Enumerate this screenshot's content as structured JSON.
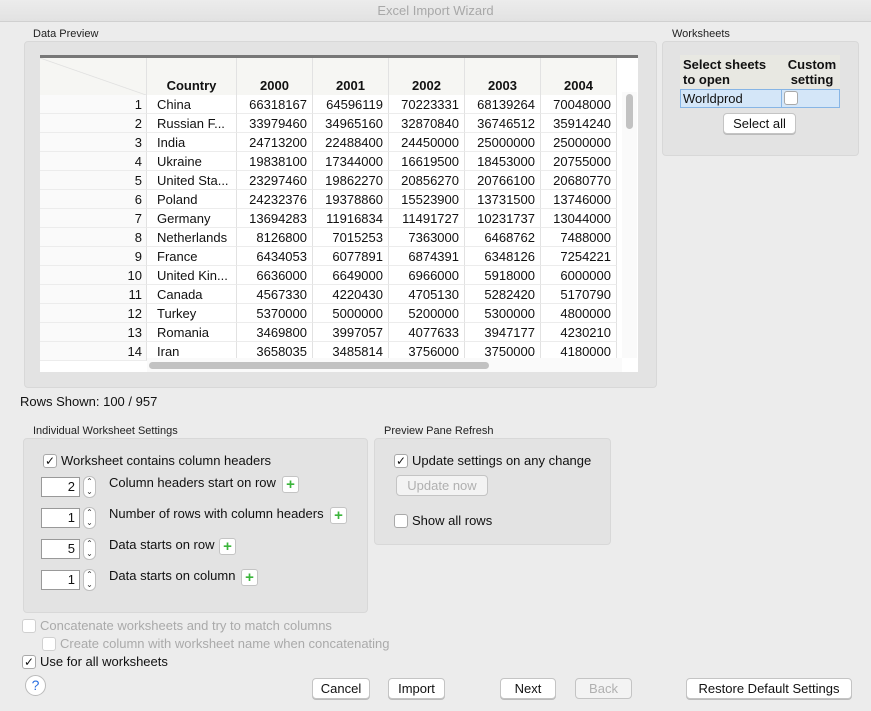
{
  "window": {
    "title": "Excel Import Wizard"
  },
  "preview": {
    "label": "Data Preview",
    "rows_shown": "Rows Shown: 100 / 957",
    "columns": [
      "Country",
      "2000",
      "2001",
      "2002",
      "2003",
      "2004"
    ],
    "rows": [
      [
        "1",
        "China",
        "66318167",
        "64596119",
        "70223331",
        "68139264",
        "70048000"
      ],
      [
        "2",
        "Russian F...",
        "33979460",
        "34965160",
        "32870840",
        "36746512",
        "35914240"
      ],
      [
        "3",
        "India",
        "24713200",
        "22488400",
        "24450000",
        "25000000",
        "25000000"
      ],
      [
        "4",
        "Ukraine",
        "19838100",
        "17344000",
        "16619500",
        "18453000",
        "20755000"
      ],
      [
        "5",
        "United Sta...",
        "23297460",
        "19862270",
        "20856270",
        "20766100",
        "20680770"
      ],
      [
        "6",
        "Poland",
        "24232376",
        "19378860",
        "15523900",
        "13731500",
        "13746000"
      ],
      [
        "7",
        "Germany",
        "13694283",
        "11916834",
        "11491727",
        "10231737",
        "13044000"
      ],
      [
        "8",
        "Netherlands",
        "8126800",
        "7015253",
        "7363000",
        "6468762",
        "7488000"
      ],
      [
        "9",
        "France",
        "6434053",
        "6077891",
        "6874391",
        "6348126",
        "7254221"
      ],
      [
        "10",
        "United Kin...",
        "6636000",
        "6649000",
        "6966000",
        "5918000",
        "6000000"
      ],
      [
        "11",
        "Canada",
        "4567330",
        "4220430",
        "4705130",
        "5282420",
        "5170790"
      ],
      [
        "12",
        "Turkey",
        "5370000",
        "5000000",
        "5200000",
        "5300000",
        "4800000"
      ],
      [
        "13",
        "Romania",
        "3469800",
        "3997057",
        "4077633",
        "3947177",
        "4230210"
      ],
      [
        "14",
        "Iran",
        "3658035",
        "3485814",
        "3756000",
        "3750000",
        "4180000"
      ]
    ]
  },
  "worksheets": {
    "label": "Worksheets",
    "col_select": "Select sheets to open",
    "col_custom": "Custom setting",
    "sheet": "Worldprod",
    "select_all": "Select all"
  },
  "settings": {
    "label": "Individual Worksheet Settings",
    "contains_headers": "Worksheet contains column headers",
    "fields": [
      {
        "value": "2",
        "label": "Column headers start on row"
      },
      {
        "value": "1",
        "label": "Number of rows with column headers"
      },
      {
        "value": "5",
        "label": "Data starts on row"
      },
      {
        "value": "1",
        "label": "Data starts on column"
      }
    ]
  },
  "refresh": {
    "label": "Preview Pane Refresh",
    "update_any": "Update settings on any change",
    "update_now": "Update now",
    "show_all": "Show all rows"
  },
  "options": {
    "concatenate": "Concatenate worksheets and try to match columns",
    "create_col": "Create column with worksheet name when concatenating",
    "use_all": "Use for all worksheets"
  },
  "buttons": {
    "help": "?",
    "cancel": "Cancel",
    "import": "Import",
    "next": "Next",
    "back": "Back",
    "restore": "Restore Default Settings"
  }
}
